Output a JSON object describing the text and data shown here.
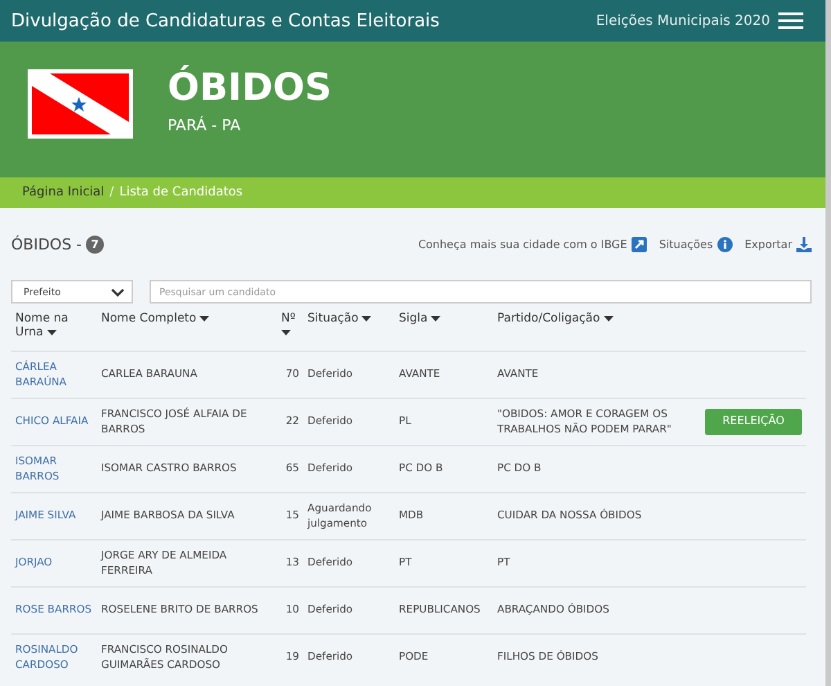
{
  "header": {
    "title": "Divulgação de Candidaturas e Contas Eleitorais",
    "election": "Eleições Municipais 2020"
  },
  "banner": {
    "city": "ÓBIDOS",
    "state": "PARÁ - PA"
  },
  "breadcrumb_separator": "/",
  "breadcrumb": [
    {
      "label": "Página Inicial",
      "current": false
    },
    {
      "label": "Lista de Candidatos",
      "current": true
    }
  ],
  "section": {
    "title": "ÓBIDOS -",
    "count": "7",
    "links": [
      {
        "label": "Conheça mais sua cidade com o IBGE",
        "kind": "external"
      },
      {
        "label": "Situações",
        "kind": "info"
      },
      {
        "label": "Exportar",
        "kind": "download"
      }
    ]
  },
  "filter": {
    "value": "Prefeito"
  },
  "search": {
    "placeholder": "Pesquisar um candidato"
  },
  "table": {
    "columns": [
      "Nome na Urna",
      "Nome Completo",
      "Nº",
      "Situação",
      "Sigla",
      "Partido/Coligação"
    ],
    "rows": [
      {
        "ballot_name": "CÁRLEA BARAÚNA",
        "full_name": "CARLEA BARAUNA",
        "number": "70",
        "status": "Deferido",
        "party": "AVANTE",
        "coalition": "AVANTE"
      },
      {
        "ballot_name": "CHICO ALFAIA",
        "full_name": "FRANCISCO JOSÉ ALFAIA DE BARROS",
        "number": "22",
        "status": "Deferido",
        "party": "PL",
        "coalition": "\"OBIDOS: AMOR E CORAGEM OS TRABALHOS NÃO PODEM PARAR\"",
        "badge": "REELEIÇÃO"
      },
      {
        "ballot_name": "ISOMAR BARROS",
        "full_name": "ISOMAR CASTRO BARROS",
        "number": "65",
        "status": "Deferido",
        "party": "PC DO B",
        "coalition": "PC DO B"
      },
      {
        "ballot_name": "JAIME SILVA",
        "full_name": "JAIME BARBOSA DA SILVA",
        "number": "15",
        "status": "Aguardando julgamento",
        "party": "MDB",
        "coalition": "CUIDAR DA NOSSA ÓBIDOS"
      },
      {
        "ballot_name": "JORJAO",
        "full_name": "JORGE ARY DE ALMEIDA FERREIRA",
        "number": "13",
        "status": "Deferido",
        "party": "PT",
        "coalition": "PT"
      },
      {
        "ballot_name": "ROSE BARROS",
        "full_name": "ROSELENE BRITO DE BARROS",
        "number": "10",
        "status": "Deferido",
        "party": "REPUBLICANOS",
        "coalition": "ABRAÇANDO ÓBIDOS"
      },
      {
        "ballot_name": "ROSINALDO CARDOSO",
        "full_name": "FRANCISCO ROSINALDO GUIMARÃES CARDOSO",
        "number": "19",
        "status": "Deferido",
        "party": "PODE",
        "coalition": "FILHOS DE ÓBIDOS"
      }
    ]
  }
}
